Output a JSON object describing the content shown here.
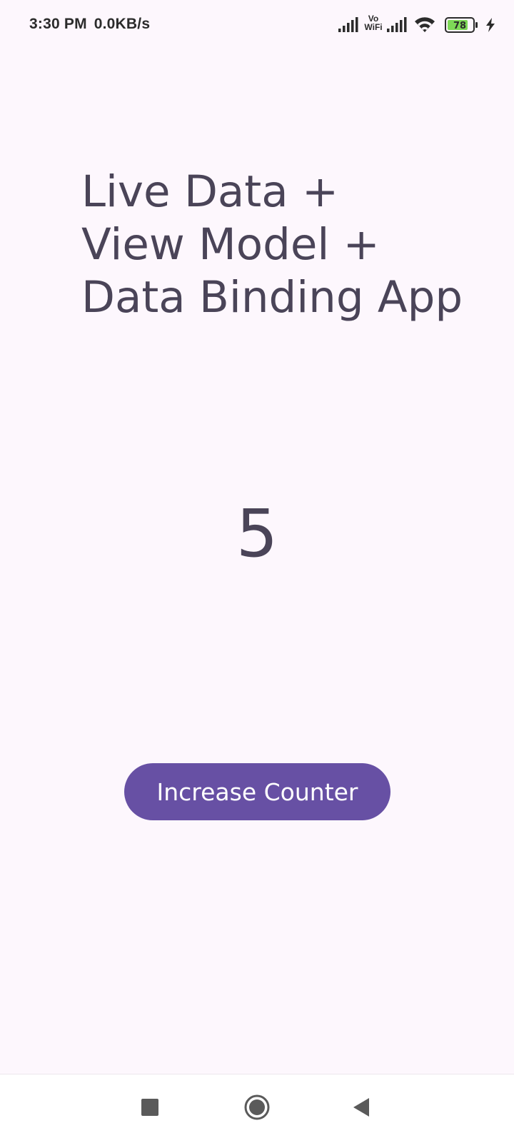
{
  "status_bar": {
    "time": "3:30 PM",
    "net_speed": "0.0KB/s",
    "vowifi_top": "Vo",
    "vowifi_bottom": "WiFi",
    "battery_level": "78",
    "icons": [
      "signal-icon",
      "vowifi-icon",
      "signal-icon",
      "wifi-icon",
      "battery-icon",
      "charging-icon"
    ]
  },
  "main": {
    "title": "Live Data +\nView Model +\nData Binding App",
    "counter_value": "5",
    "button_label": "Increase Counter"
  },
  "nav_bar": {
    "icons": [
      "recents-icon",
      "home-icon",
      "back-icon"
    ]
  },
  "colors": {
    "background": "#fdf7fd",
    "text": "#4a4458",
    "primary": "#6750a4",
    "on_primary": "#ffffff",
    "battery_fill": "#7ed957"
  }
}
